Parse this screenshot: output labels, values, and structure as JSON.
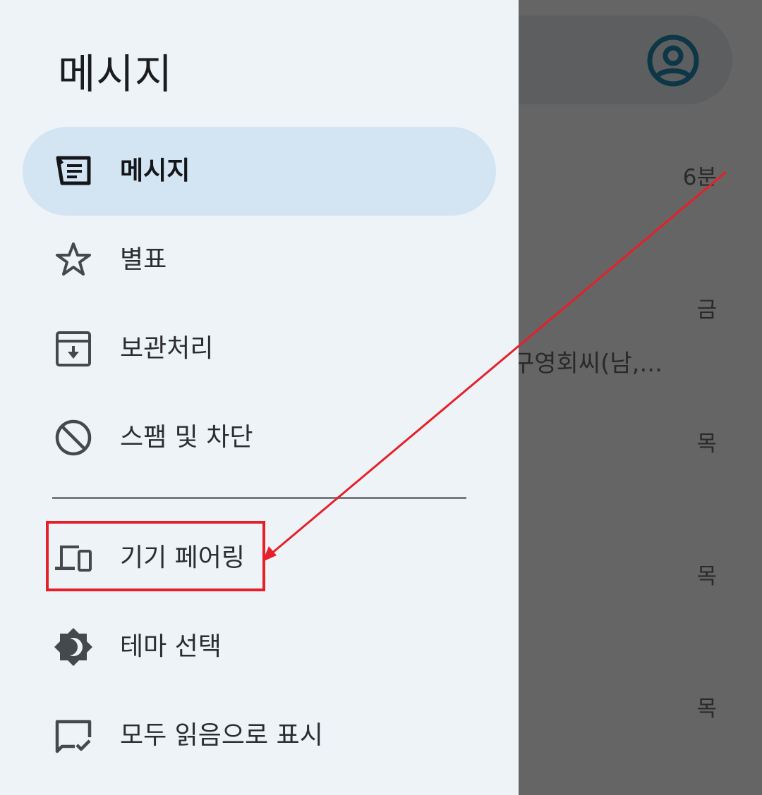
{
  "drawer": {
    "title": "메시지",
    "items": [
      {
        "label": "메시지",
        "icon": "messages-icon",
        "selected": true
      },
      {
        "label": "별표",
        "icon": "star-icon",
        "selected": false
      },
      {
        "label": "보관처리",
        "icon": "archive-icon",
        "selected": false
      },
      {
        "label": "스팸 및 차단",
        "icon": "block-icon",
        "selected": false
      },
      {
        "label": "기기 페어링",
        "icon": "devices-icon",
        "selected": false
      },
      {
        "label": "테마 선택",
        "icon": "theme-icon",
        "selected": false
      },
      {
        "label": "모두 읽음으로 표시",
        "icon": "mark-read-icon",
        "selected": false
      }
    ]
  },
  "background": {
    "times": [
      "6분",
      "금",
      "목",
      "목",
      "목"
    ],
    "snippet": "구영회씨(남,..."
  },
  "annotation": {
    "color": "#e5202a",
    "target": "기기 페어링"
  },
  "colors": {
    "drawer_bg": "#eef3f8",
    "selected_bg": "#d3e4f3",
    "scrim": "#656565",
    "avatar": "#0d3646"
  }
}
